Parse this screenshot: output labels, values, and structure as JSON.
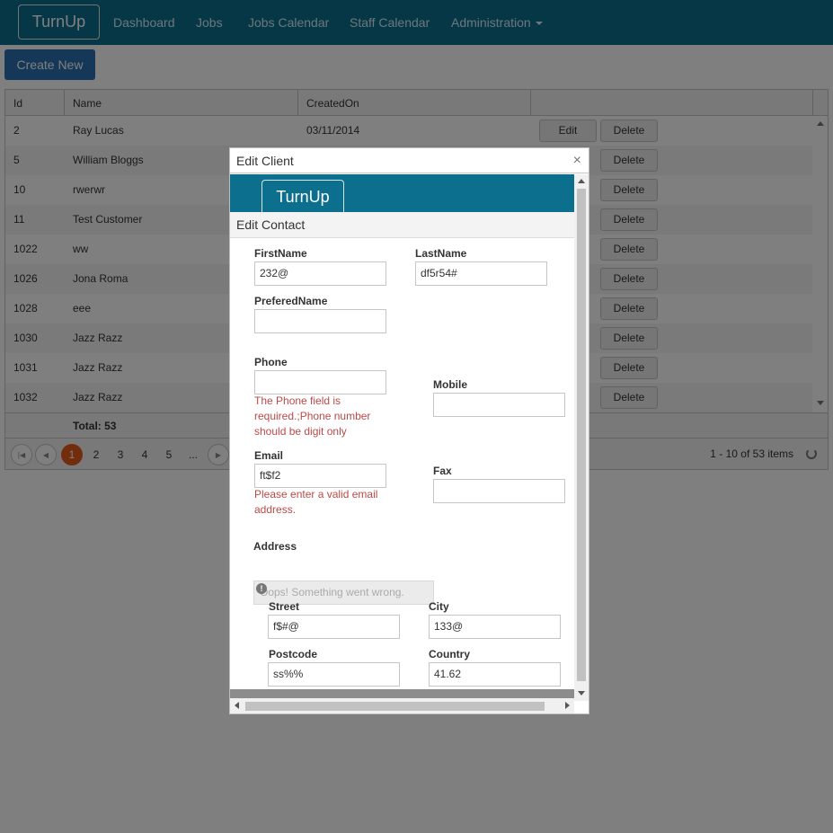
{
  "navbar": {
    "brand": "TurnUp",
    "items": [
      "Dashboard",
      "Jobs",
      "Jobs Calendar",
      "Staff Calendar",
      "Administration"
    ]
  },
  "create_button": "Create New",
  "grid": {
    "columns": [
      "Id",
      "Name",
      "CreatedOn"
    ],
    "rows": [
      {
        "id": "2",
        "name": "Ray Lucas",
        "created": "03/11/2014"
      },
      {
        "id": "5",
        "name": "William Bloggs",
        "created": ""
      },
      {
        "id": "10",
        "name": "rwerwr",
        "created": ""
      },
      {
        "id": "11",
        "name": "Test Customer",
        "created": ""
      },
      {
        "id": "1022",
        "name": "ww",
        "created": ""
      },
      {
        "id": "1026",
        "name": "Jona Roma",
        "created": ""
      },
      {
        "id": "1028",
        "name": "eee",
        "created": ""
      },
      {
        "id": "1030",
        "name": "Jazz Razz",
        "created": ""
      },
      {
        "id": "1031",
        "name": "Jazz Razz",
        "created": ""
      },
      {
        "id": "1032",
        "name": "Jazz Razz",
        "created": ""
      }
    ],
    "edit_label": "Edit",
    "delete_label": "Delete",
    "total": "Total: 53",
    "pages": [
      "1",
      "2",
      "3",
      "4",
      "5",
      "..."
    ],
    "active_page": "1",
    "pager_info": "1 - 10 of 53 items"
  },
  "modal": {
    "title": "Edit Client",
    "close": "×",
    "inner_brand": "TurnUp",
    "inner_title": "Edit Contact",
    "fields": {
      "firstname": {
        "label": "FirstName",
        "value": "232@"
      },
      "lastname": {
        "label": "LastName",
        "value": "df5r54#"
      },
      "preferedname": {
        "label": "PreferedName",
        "value": ""
      },
      "phone": {
        "label": "Phone",
        "value": ""
      },
      "mobile": {
        "label": "Mobile",
        "value": ""
      },
      "email": {
        "label": "Email",
        "value": "ft$f2"
      },
      "fax": {
        "label": "Fax",
        "value": ""
      },
      "street": {
        "label": "Street",
        "value": "f$#@"
      },
      "city": {
        "label": "City",
        "value": "133@"
      },
      "postcode": {
        "label": "Postcode",
        "value": "ss%%"
      },
      "country": {
        "label": "Country",
        "value": "41.62"
      }
    },
    "phone_error": [
      "The Phone field is",
      "required.;Phone number",
      "should be digit only"
    ],
    "email_error": [
      "Please enter a valid email",
      "address."
    ],
    "address_label": "Address",
    "address_error": "Oops! Something went wrong."
  },
  "colors": {
    "navbar": "#0b6f8d",
    "primary_button": "#2a6eb0",
    "active_page": "#e45a1b",
    "error_text": "#b94a48"
  }
}
